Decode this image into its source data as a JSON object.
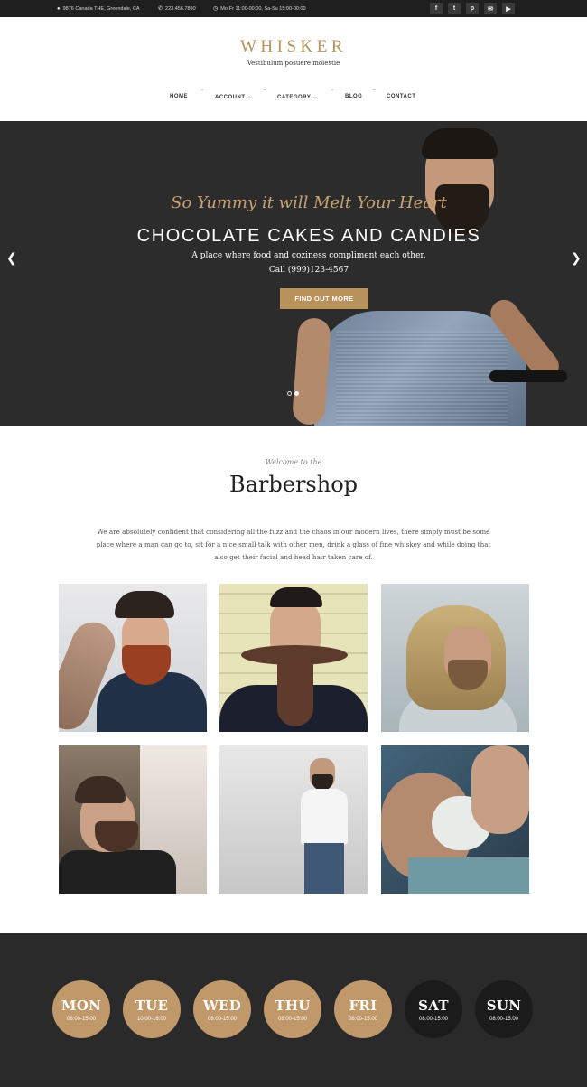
{
  "topbar": {
    "address": "9876 Canada THE, Greendale, CA",
    "phone": "223.456.7890",
    "hours": "Mo-Fr 11:00-00:00, Sa-Su 15:00-00:00",
    "social": [
      {
        "icon": "facebook-icon",
        "glyph": "f"
      },
      {
        "icon": "twitter-icon",
        "glyph": "t"
      },
      {
        "icon": "pinterest-icon",
        "glyph": "p"
      },
      {
        "icon": "email-icon",
        "glyph": "✉"
      },
      {
        "icon": "youtube-icon",
        "glyph": "▶"
      }
    ]
  },
  "header": {
    "logo": "WHISKER",
    "tagline": "Vestibulum posuere molestie"
  },
  "nav": {
    "home": "HOME",
    "account": "ACCOUNT",
    "category": "CATEGORY",
    "blog": "BLOG",
    "contact": "CONTACT"
  },
  "hero": {
    "script": "So Yummy it will Melt Your Heart",
    "title": "CHOCOLATE CAKES AND CANDIES",
    "subtitle": "A place where food and coziness compliment each other.",
    "phone": "Call (999)123-4567",
    "cta": "FIND OUT MORE"
  },
  "welcome": {
    "pre": "Welcome to the",
    "title": "Barbershop",
    "text": "We are absolutely confident that considering all the fuzz and the chaos in our modern lives, there simply must be some place where a man can go to, sit for a nice small talk with other men, drink a glass of fine whiskey and while doing that also get their facial and head hair taken care of."
  },
  "hours": {
    "days": [
      {
        "name": "MON",
        "time": "08:00-15:00"
      },
      {
        "name": "TUE",
        "time": "10:00-16:00"
      },
      {
        "name": "WED",
        "time": "08:00-15:00"
      },
      {
        "name": "THU",
        "time": "08:00-15:00"
      },
      {
        "name": "FRI",
        "time": "08:00-15:00"
      },
      {
        "name": "SAT",
        "time": "08:00-15:00"
      },
      {
        "name": "SUN",
        "time": "08:00-15:00"
      }
    ]
  },
  "colors": {
    "accent": "#b8915b",
    "day_open": "#c0986a",
    "day_closed": "#1b1b1b",
    "dark_bg": "#2a2a2a"
  }
}
